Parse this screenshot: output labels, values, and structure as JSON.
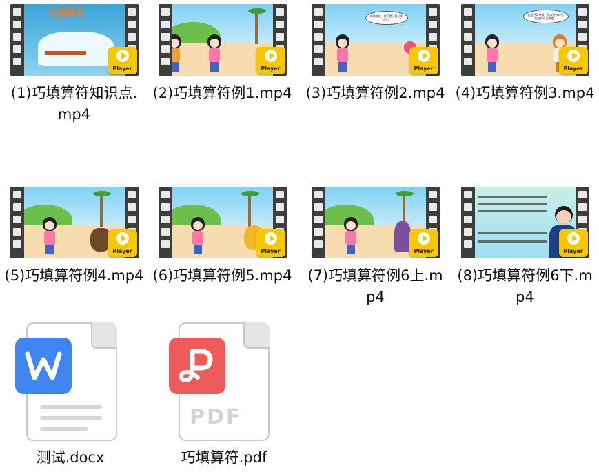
{
  "files": [
    {
      "label": "(1)巧填算符知识点.mp4",
      "icon": "video-thumbnail",
      "badge": "Player"
    },
    {
      "label": "(2)巧填算符例1.mp4",
      "icon": "video-thumbnail",
      "badge": "Player"
    },
    {
      "label": "(3)巧填算符例2.mp4",
      "icon": "video-thumbnail",
      "badge": "Player"
    },
    {
      "label": "(4)巧填算符例3.mp4",
      "icon": "video-thumbnail",
      "badge": "Player"
    },
    {
      "label": "(5)巧填算符例4.mp4",
      "icon": "video-thumbnail",
      "badge": "Player"
    },
    {
      "label": "(6)巧填算符例5.mp4",
      "icon": "video-thumbnail",
      "badge": "Player"
    },
    {
      "label": "(7)巧填算符例6上.mp4",
      "icon": "video-thumbnail",
      "badge": "Player"
    },
    {
      "label": "(8)巧填算符例6下.mp4",
      "icon": "video-thumbnail",
      "badge": "Player"
    }
  ],
  "docs": [
    {
      "label": "测试.docx",
      "icon": "word-document-icon",
      "color": "#3f86f0"
    },
    {
      "label": "巧填算符.pdf",
      "icon": "pdf-document-icon",
      "color": "#ee5b5b",
      "watermark": "PDF"
    }
  ],
  "thumb_text": {
    "title_1": "巧填算符",
    "bubble_3": "嘀嗒哈啦，你们看了我又如何了！",
    "bubble_4": "这题好简单哦，我来给你的朋友给你引出道题。"
  },
  "colors": {
    "player_badge": "#f7c800",
    "film": "#3d3d3d"
  }
}
